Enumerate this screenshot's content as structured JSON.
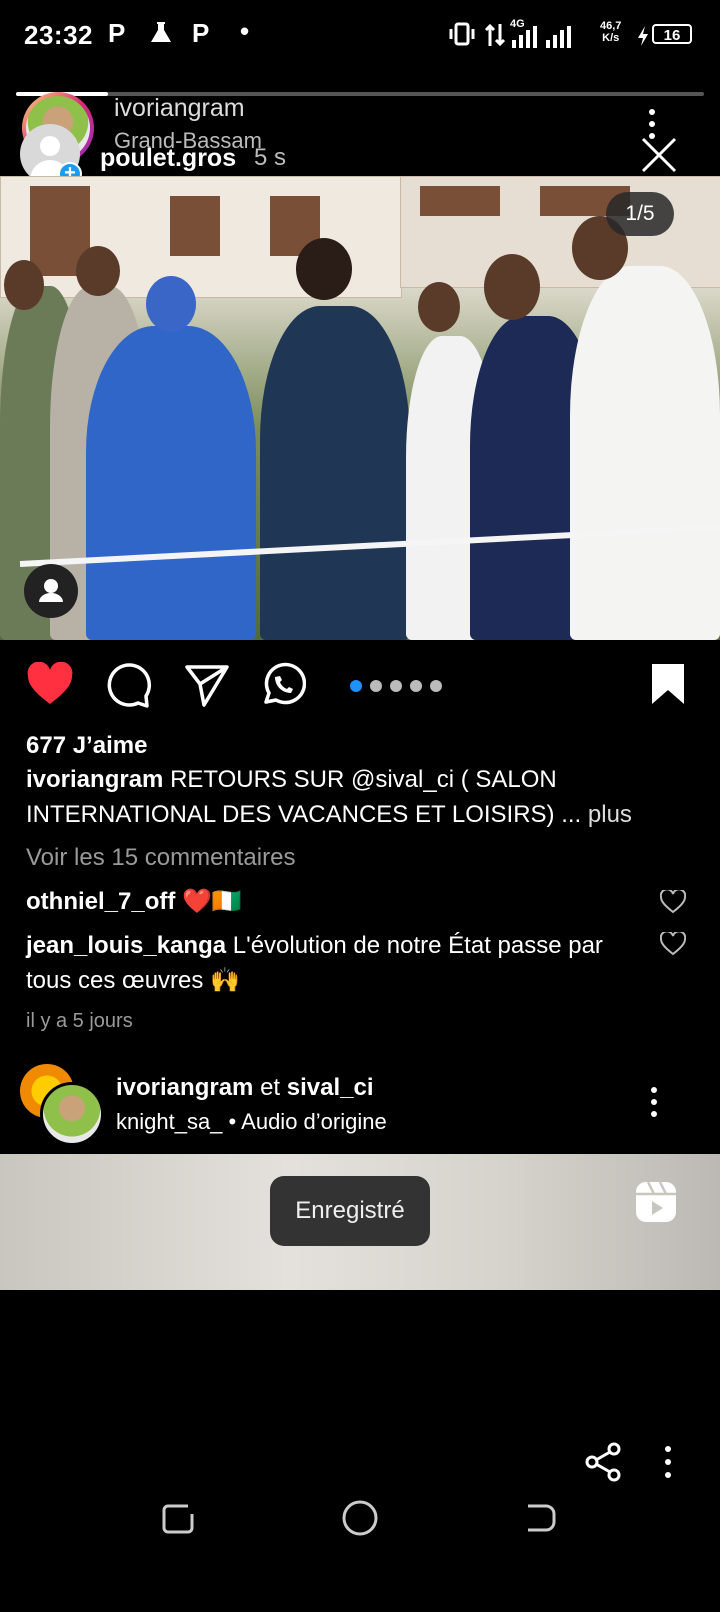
{
  "status_bar": {
    "time": "23:32",
    "notif_1": "P",
    "notif_2": "P",
    "dot": "•",
    "net_speed_1": "46,7",
    "net_speed_2": "K/s",
    "battery": "16",
    "net_type": "4G"
  },
  "story": {
    "username": "ivoriangram",
    "location": "Grand-Bassam"
  },
  "post": {
    "poster_name": "poulet.gros",
    "time_ago": "5 s",
    "page_indicator": "1/5",
    "likes": "677 J’aime",
    "caption_user": "ivoriangram",
    "caption_text": "RETOURS SUR @sival_ci ( SALON INTERNATIONAL DES VACANCES ET LOISIRS) ...",
    "caption_more": "plus",
    "view_comments": "Voir les 15 commentaires",
    "comments": [
      {
        "user": "othniel_7_off",
        "text": "❤️🇨🇮"
      },
      {
        "user": "jean_louis_kanga",
        "text": "L'évolution de notre État passe par tous ces œuvres 🙌"
      }
    ],
    "date": "il y a 5 jours"
  },
  "reel": {
    "user1": "ivoriangram",
    "conj": "et",
    "user2": "sival_ci",
    "audio_user": "knight_sa_",
    "audio_sep": "•",
    "audio_label": "Audio d’origine",
    "toast": "Enregistré"
  }
}
